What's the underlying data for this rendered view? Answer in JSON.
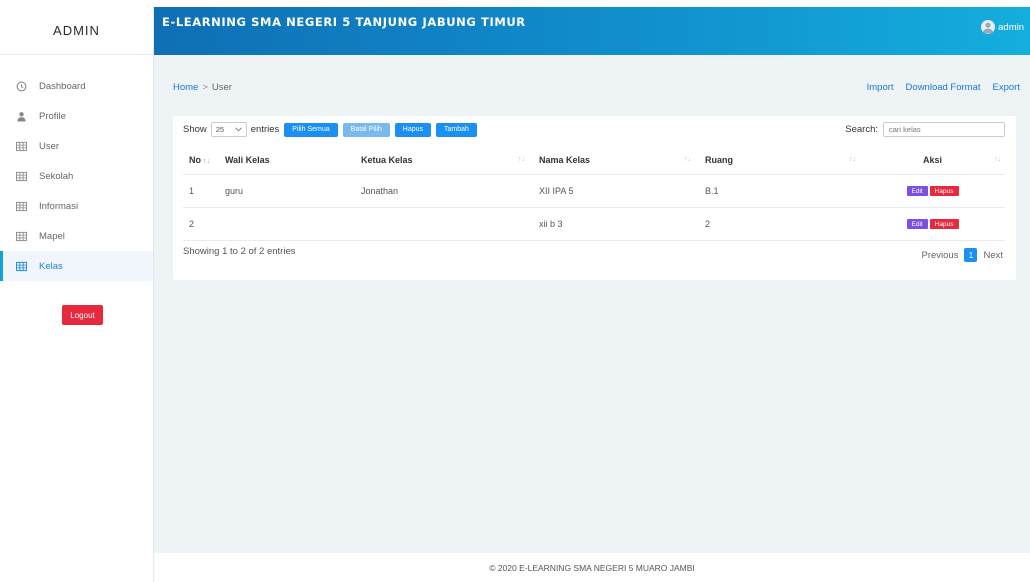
{
  "sidebar": {
    "brand": "ADMIN",
    "items": [
      {
        "label": "Dashboard",
        "icon": "clock-icon"
      },
      {
        "label": "Profile",
        "icon": "user-icon"
      },
      {
        "label": "User",
        "icon": "table-icon"
      },
      {
        "label": "Sekolah",
        "icon": "table-icon"
      },
      {
        "label": "Informasi",
        "icon": "table-icon"
      },
      {
        "label": "Mapel",
        "icon": "table-icon"
      },
      {
        "label": "Kelas",
        "icon": "table-icon",
        "active": true
      }
    ],
    "logout_label": "Logout"
  },
  "header": {
    "title": "E-LEARNING SMA NEGERI 5 TANJUNG JABUNG TIMUR",
    "user": "admin"
  },
  "breadcrumb": {
    "home": "Home",
    "separator": ">",
    "current": "User"
  },
  "top_actions": {
    "import": "Import",
    "download": "Download Format",
    "export": "Export"
  },
  "table_controls": {
    "show_label": "Show",
    "entries_value": "25",
    "entries_label": "entries",
    "buttons": {
      "pilih_semua": "Pilih Semua",
      "batal_pilih": "Batal Pilih",
      "hapus": "Hapus",
      "tambah": "Tambah"
    },
    "search_label": "Search:",
    "search_placeholder": "cari kelas"
  },
  "table": {
    "columns": [
      "No",
      "Wali Kelas",
      "Ketua Kelas",
      "Nama Kelas",
      "Ruang",
      "Aksi"
    ],
    "rows": [
      {
        "no": "1",
        "wali": "guru",
        "ketua": "Jonathan",
        "nama": "XII IPA 5",
        "ruang": "B.1"
      },
      {
        "no": "2",
        "wali": "",
        "ketua": "",
        "nama": "xii b 3",
        "ruang": "2"
      }
    ],
    "edit_label": "Edit",
    "hapus_label": "Hapus"
  },
  "pagination": {
    "info": "Showing 1 to 2 of 2 entries",
    "previous": "Previous",
    "current": "1",
    "next": "Next"
  },
  "footer": {
    "text": "© 2020 E-LEARNING SMA NEGERI 5 MUARO JAMBI"
  },
  "colors": {
    "accent": "#1b8ff2",
    "danger": "#e8283c",
    "edit": "#7b52e0",
    "header_start": "#0f6fb5",
    "header_end": "#14aedd"
  }
}
